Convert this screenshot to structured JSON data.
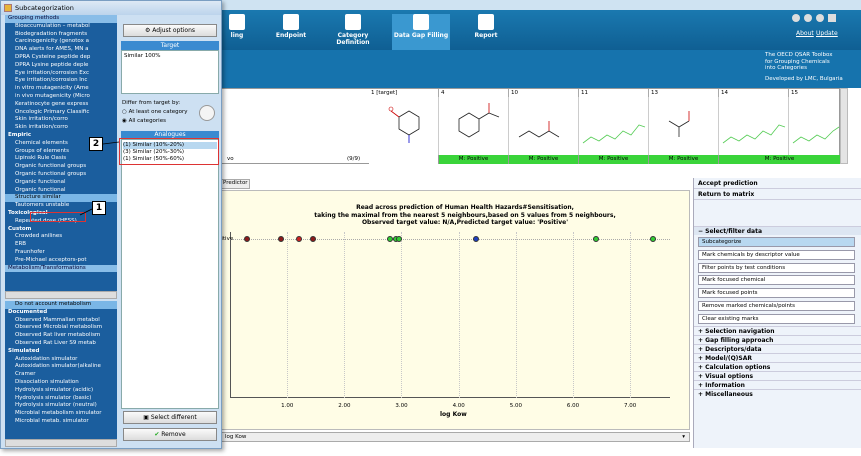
{
  "app": {
    "window_title": "",
    "about": "About",
    "update": "Update",
    "toolbar": [
      {
        "label": "ling"
      },
      {
        "label": "Endpoint"
      },
      {
        "label": "Category Definition"
      },
      {
        "label": "Data Gap Filling"
      },
      {
        "label": "Report"
      }
    ],
    "brand_lines": [
      "The OECD QSAR Toolbox",
      "for Grouping Chemicals",
      "into Categories"
    ],
    "developer": "Developed by LMC, Bulgaria"
  },
  "matrix": {
    "columns": [
      "1 [target]",
      "4",
      "10",
      "11",
      "13",
      "14",
      "15"
    ],
    "predictions": [
      "M: Positive",
      "M: Positive",
      "M: Positive",
      "M: Positive",
      "M: Positive"
    ],
    "row_left_label": "vo",
    "row_count": "(9/9)",
    "tab_label": "Predictor"
  },
  "plot": {
    "title_lines": [
      "Read across prediction of Human Health Hazards#Sensitisation,",
      "taking the maximal from the nearest 5 neighbours,based on 5 values from 5 neighbours,",
      "Observed target value: N/A,Predicted target value: 'Positive'"
    ],
    "xlabel": "log Kow",
    "ylabel_left": "Positive",
    "combo_value": "log Kow"
  },
  "chart_data": {
    "type": "scatter",
    "xlabel": "log Kow",
    "xticks": [
      "1.00",
      "2.00",
      "3.00",
      "4.00",
      "5.00",
      "6.00",
      "7.00"
    ],
    "points": [
      {
        "x": 0.3,
        "y": "Positive",
        "color": "#8b1a1a"
      },
      {
        "x": 0.9,
        "y": "Positive",
        "color": "#8b1a1a"
      },
      {
        "x": 1.2,
        "y": "Positive",
        "color": "#cc2222"
      },
      {
        "x": 1.45,
        "y": "Positive",
        "color": "#8b1a1a"
      },
      {
        "x": 2.8,
        "y": "Positive",
        "color": "#33cc33"
      },
      {
        "x": 2.9,
        "y": "Positive",
        "color": "#33cc33"
      },
      {
        "x": 2.95,
        "y": "Positive",
        "color": "#33cc33"
      },
      {
        "x": 4.3,
        "y": "Positive",
        "color": "#1e3fbf"
      },
      {
        "x": 6.4,
        "y": "Positive",
        "color": "#33cc33"
      },
      {
        "x": 7.4,
        "y": "Positive",
        "color": "#33cc33"
      }
    ]
  },
  "right_panel": {
    "accept": "Accept prediction",
    "return": "Return to matrix",
    "select_filter": "Select/filter data",
    "buttons": [
      "Subcategorize",
      "Mark chemicals by descriptor value",
      "Filter points by test conditions",
      "Mark focused chemical",
      "Mark focused points",
      "Remove marked chemicals/points",
      "Clear existing marks"
    ],
    "sections": [
      "Selection navigation",
      "Gap filling approach",
      "Descriptors/data",
      "Model/(Q)SAR",
      "Calculation options",
      "Visual options",
      "Information",
      "Miscellaneous"
    ]
  },
  "dialog": {
    "title": "Subcategorization",
    "adjust_button": "Adjust options",
    "target_header": "Target",
    "target_value": "Similar 100%",
    "differ_label": "Differ from target by:",
    "radio_one": "At least one category",
    "radio_all": "All categories",
    "analogues_header": "Analogues",
    "analogues": [
      "(1) Similar (10%-20%)",
      "(3) Similar (20%-30%)",
      "(1) Similar (50%-60%)"
    ],
    "select_different": "Select different",
    "remove": "Remove",
    "callouts": [
      "2",
      "1"
    ],
    "tree_top": [
      {
        "t": "Grouping methods",
        "k": "cap"
      },
      {
        "t": "Bioaccumulation – metabol",
        "k": ""
      },
      {
        "t": "Biodegradation fragments",
        "k": ""
      },
      {
        "t": "Carcinogenicity (genotox a",
        "k": ""
      },
      {
        "t": "DNA alerts for AMES, MN a",
        "k": ""
      },
      {
        "t": "DPRA Cysteine peptide dep",
        "k": ""
      },
      {
        "t": "DPRA Lysine peptide deple",
        "k": ""
      },
      {
        "t": "Eye irritation/corrosion Exc",
        "k": ""
      },
      {
        "t": "Eye irritation/corrosion Inc",
        "k": ""
      },
      {
        "t": "in vitro mutagenicity (Ame",
        "k": ""
      },
      {
        "t": "in vivo mutagenicity (Micro",
        "k": ""
      },
      {
        "t": "Keratinocyte gene express",
        "k": ""
      },
      {
        "t": "Oncologic Primary Classific",
        "k": ""
      },
      {
        "t": "Skin irritation/corro",
        "k": ""
      },
      {
        "t": "Skin irritation/corro",
        "k": ""
      },
      {
        "t": "Empiric",
        "k": "h"
      },
      {
        "t": "Chemical elements",
        "k": ""
      },
      {
        "t": "Groups of elements",
        "k": ""
      },
      {
        "t": "Lipinski Rule Oasis",
        "k": ""
      },
      {
        "t": "Organic functional groups",
        "k": ""
      },
      {
        "t": "Organic functional groups",
        "k": ""
      },
      {
        "t": "Organic functional",
        "k": ""
      },
      {
        "t": "Organic functional",
        "k": ""
      },
      {
        "t": "Structure similar",
        "k": "sel"
      },
      {
        "t": "Tautomers unstable",
        "k": ""
      },
      {
        "t": "Toxicological",
        "k": "h"
      },
      {
        "t": "Repeated dose (HESS)",
        "k": ""
      },
      {
        "t": "Custom",
        "k": "h"
      },
      {
        "t": "Crowded anilines",
        "k": ""
      },
      {
        "t": "ERB",
        "k": ""
      },
      {
        "t": "Fraunhofer",
        "k": ""
      },
      {
        "t": "Pre-Michael acceptors-pot",
        "k": ""
      },
      {
        "t": "Metabolism/Transformations",
        "k": "cap"
      }
    ],
    "tree_bottom": [
      {
        "t": "Do not account metabolism",
        "k": "sel"
      },
      {
        "t": "Documented",
        "k": "h"
      },
      {
        "t": "Observed Mammalian metabol",
        "k": ""
      },
      {
        "t": "Observed Microbial metabolism",
        "k": ""
      },
      {
        "t": "Observed Rat liver metabolism",
        "k": ""
      },
      {
        "t": "Observed Rat Liver S9 metab",
        "k": ""
      },
      {
        "t": "Simulated",
        "k": "h"
      },
      {
        "t": "Autoxidation simulator",
        "k": ""
      },
      {
        "t": "Autoxidation simulator(alkaline",
        "k": ""
      },
      {
        "t": "Cramer",
        "k": ""
      },
      {
        "t": "Dissociation simulation",
        "k": ""
      },
      {
        "t": "Hydrolysis simulator (acidic)",
        "k": ""
      },
      {
        "t": "Hydrolysis simulator (basic)",
        "k": ""
      },
      {
        "t": "Hydrolysis simulator (neutral)",
        "k": ""
      },
      {
        "t": "Microbial metabolism simulator",
        "k": ""
      },
      {
        "t": "Microbial metab. simulator",
        "k": ""
      }
    ]
  }
}
